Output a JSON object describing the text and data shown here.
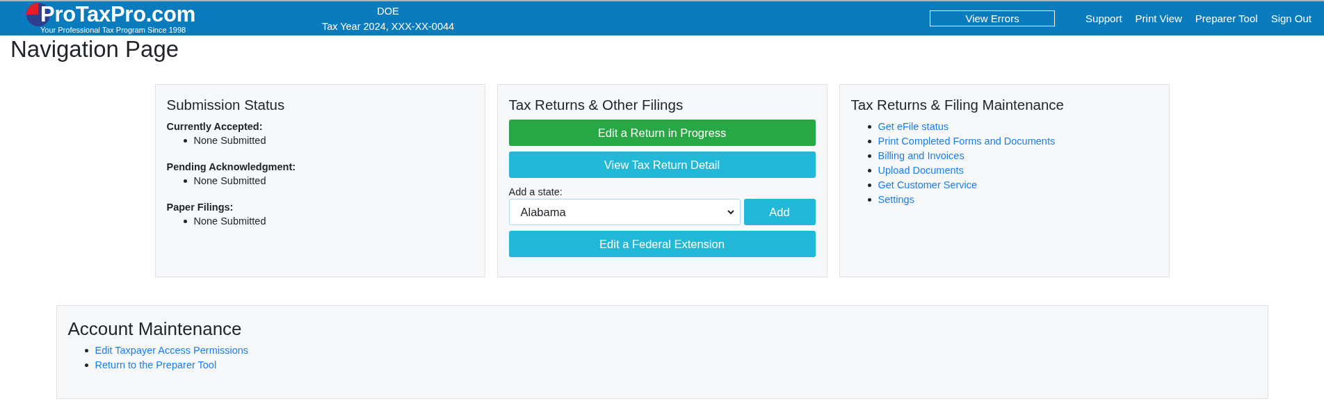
{
  "header": {
    "logo": {
      "name": "ProTaxPro.com",
      "tagline": "Your Professional Tax Program Since 1998"
    },
    "client": {
      "name": "DOE",
      "detail": "Tax Year 2024, XXX-XX-0044"
    },
    "view_errors": "View Errors",
    "nav": [
      "Support",
      "Print View",
      "Preparer Tool",
      "Sign Out"
    ]
  },
  "page_title": "Navigation Page",
  "submission_status": {
    "title": "Submission Status",
    "groups": [
      {
        "label": "Currently Accepted:",
        "items": [
          "None Submitted"
        ]
      },
      {
        "label": "Pending Acknowledgment:",
        "items": [
          "None Submitted"
        ]
      },
      {
        "label": "Paper Filings:",
        "items": [
          "None Submitted"
        ]
      }
    ]
  },
  "filings": {
    "title": "Tax Returns & Other Filings",
    "buttons": [
      {
        "label": "Edit a Return in Progress",
        "kind": "success"
      },
      {
        "label": "View Tax Return Detail",
        "kind": "info"
      }
    ],
    "state_label": "Add a state:",
    "state_value": "Alabama",
    "add": "Add",
    "extension": "Edit a Federal Extension"
  },
  "maintenance": {
    "title": "Tax Returns & Filing Maintenance",
    "links": [
      "Get eFile status",
      "Print Completed Forms and Documents",
      "Billing and Invoices",
      "Upload Documents",
      "Get Customer Service",
      "Settings"
    ]
  },
  "account": {
    "title": "Account Maintenance",
    "links": [
      "Edit Taxpayer Access Permissions",
      "Return to the Preparer Tool"
    ]
  }
}
